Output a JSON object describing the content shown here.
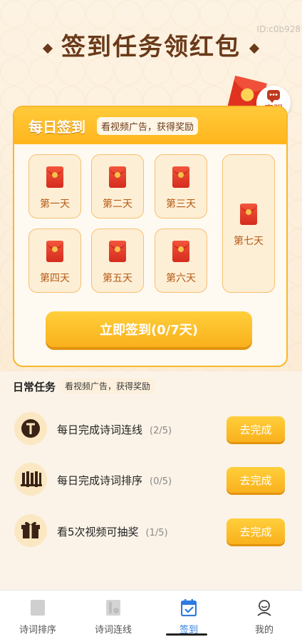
{
  "header": {
    "id_label": "ID:c0b928",
    "title": "签到任务领红包",
    "service_label": "客服"
  },
  "daily": {
    "title": "每日签到",
    "subtitle": "看视频广告，获得奖励",
    "days": [
      "第一天",
      "第二天",
      "第三天",
      "第四天",
      "第五天",
      "第六天",
      "第七天"
    ],
    "sign_button": "立即签到(0/7天)"
  },
  "tasks": {
    "title": "日常任务",
    "subtitle": "看视频广告，获得奖励",
    "items": [
      {
        "name": "每日完成诗词连线",
        "progress": "(2/5)",
        "button": "去完成",
        "icon": "t-badge-icon"
      },
      {
        "name": "每日完成诗词排序",
        "progress": "(0/5)",
        "button": "去完成",
        "icon": "bars-sort-icon"
      },
      {
        "name": "看5次视频可抽奖",
        "progress": "(1/5)",
        "button": "去完成",
        "icon": "gift-icon"
      }
    ]
  },
  "tabbar": {
    "items": [
      {
        "label": "诗词排序",
        "icon": "sort-icon",
        "active": false
      },
      {
        "label": "诗词连线",
        "icon": "link-icon",
        "active": false
      },
      {
        "label": "签到",
        "icon": "calendar-check-icon",
        "active": true
      },
      {
        "label": "我的",
        "icon": "user-icon",
        "active": false
      }
    ]
  },
  "colors": {
    "accent": "#f9b11c",
    "title": "#6a3a1a",
    "active_tab": "#2d7be0",
    "envelope": "#d52c1e"
  }
}
